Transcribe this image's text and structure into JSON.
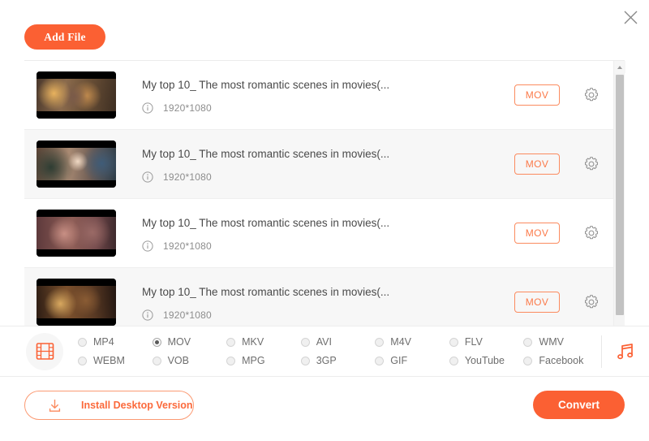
{
  "window": {
    "close_icon": "close-icon"
  },
  "toolbar": {
    "add_file_label": "Add File"
  },
  "file_list": {
    "scrollbar": {
      "up_arrow_icon": "chevron-up-icon"
    },
    "items": [
      {
        "title": "My top 10_ The most romantic scenes in movies(...",
        "info_icon": "info-icon",
        "resolution": "1920*1080",
        "format_label": "MOV",
        "settings_icon": "gear-icon"
      },
      {
        "title": "My top 10_ The most romantic scenes in movies(...",
        "info_icon": "info-icon",
        "resolution": "1920*1080",
        "format_label": "MOV",
        "settings_icon": "gear-icon"
      },
      {
        "title": "My top 10_ The most romantic scenes in movies(...",
        "info_icon": "info-icon",
        "resolution": "1920*1080",
        "format_label": "MOV",
        "settings_icon": "gear-icon"
      },
      {
        "title": "My top 10_ The most romantic scenes in movies(...",
        "info_icon": "info-icon",
        "resolution": "1920*1080",
        "format_label": "MOV",
        "settings_icon": "gear-icon"
      }
    ]
  },
  "format_bar": {
    "video_icon": "film-strip-icon",
    "audio_icon": "music-note-icon",
    "selected": "MOV",
    "options": [
      {
        "label": "MP4",
        "selected": false
      },
      {
        "label": "MOV",
        "selected": true
      },
      {
        "label": "MKV",
        "selected": false
      },
      {
        "label": "AVI",
        "selected": false
      },
      {
        "label": "M4V",
        "selected": false
      },
      {
        "label": "FLV",
        "selected": false
      },
      {
        "label": "WMV",
        "selected": false
      },
      {
        "label": "WEBM",
        "selected": false
      },
      {
        "label": "VOB",
        "selected": false
      },
      {
        "label": "MPG",
        "selected": false
      },
      {
        "label": "3GP",
        "selected": false
      },
      {
        "label": "GIF",
        "selected": false
      },
      {
        "label": "YouTube",
        "selected": false
      },
      {
        "label": "Facebook",
        "selected": false
      }
    ]
  },
  "footer": {
    "install_label": "Install Desktop Version",
    "install_icon": "download-icon",
    "convert_label": "Convert"
  },
  "colors": {
    "accent": "#fb6033",
    "accent_light": "#fb8b5f",
    "text": "#4a4a4a",
    "muted": "#8d8d8d"
  }
}
